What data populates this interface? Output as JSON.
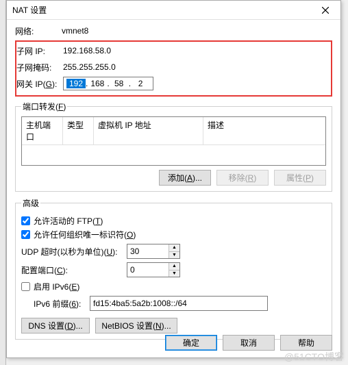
{
  "title": "NAT 设置",
  "network": {
    "label": "网络:",
    "value": "vmnet8"
  },
  "subnet_ip": {
    "label": "子网 IP:",
    "value": "192.168.58.0"
  },
  "subnet_mask": {
    "label": "子网掩码:",
    "value": "255.255.255.0"
  },
  "gateway": {
    "label": "网关 IP(G):",
    "seg1": "192",
    "seg2": "168",
    "seg3": "58",
    "seg4": "2"
  },
  "port_forward": {
    "legend": "端口转发(F)",
    "cols": {
      "c1": "主机端口",
      "c2": "类型",
      "c3": "虚拟机 IP 地址",
      "c4": "描述"
    },
    "btn_add": "添加(A)...",
    "btn_remove": "移除(R)",
    "btn_props": "属性(P)"
  },
  "advanced": {
    "legend": "高级",
    "ftp": "允许活动的 FTP(T)",
    "org_id": "允许任何组织唯一标识符(O)",
    "udp_label": "UDP 超时(以秒为单位)(U):",
    "udp_value": "30",
    "cfg_port_label": "配置端口(C):",
    "cfg_port_value": "0",
    "ipv6_enable": "启用 IPv6(E)",
    "ipv6_prefix_label": "IPv6 前缀(6):",
    "ipv6_prefix_value": "fd15:4ba5:5a2b:1008::/64",
    "btn_dns": "DNS 设置(D)...",
    "btn_netbios": "NetBIOS 设置(N)..."
  },
  "buttons": {
    "ok": "确定",
    "cancel": "取消",
    "help": "帮助"
  },
  "watermark": "@51CTO博客"
}
